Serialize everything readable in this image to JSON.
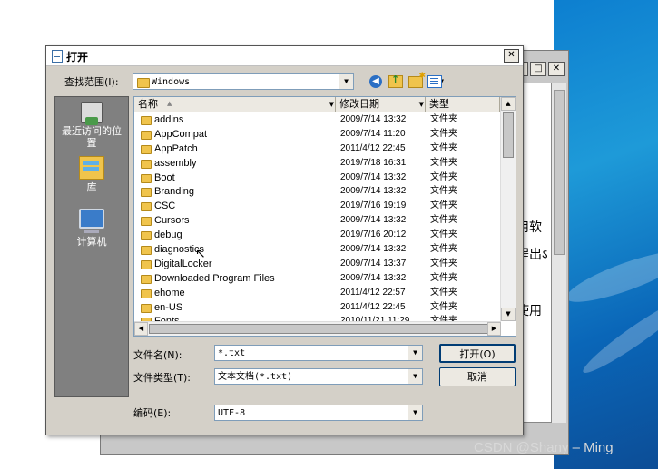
{
  "dialog": {
    "title": "打开",
    "close": "✕"
  },
  "lookin": {
    "label": "查找范围(I):",
    "value": "Windows"
  },
  "places": {
    "recent": "最近访问的位置",
    "library": "库",
    "computer": "计算机"
  },
  "columns": {
    "name": "名称",
    "date": "修改日期",
    "type": "类型"
  },
  "files": [
    {
      "name": "addins",
      "date": "2009/7/14 13:32",
      "type": "文件夹"
    },
    {
      "name": "AppCompat",
      "date": "2009/7/14 11:20",
      "type": "文件夹"
    },
    {
      "name": "AppPatch",
      "date": "2011/4/12 22:45",
      "type": "文件夹"
    },
    {
      "name": "assembly",
      "date": "2019/7/18 16:31",
      "type": "文件夹"
    },
    {
      "name": "Boot",
      "date": "2009/7/14 13:32",
      "type": "文件夹"
    },
    {
      "name": "Branding",
      "date": "2009/7/14 13:32",
      "type": "文件夹"
    },
    {
      "name": "CSC",
      "date": "2019/7/16 19:19",
      "type": "文件夹"
    },
    {
      "name": "Cursors",
      "date": "2009/7/14 13:32",
      "type": "文件夹"
    },
    {
      "name": "debug",
      "date": "2019/7/16 20:12",
      "type": "文件夹"
    },
    {
      "name": "diagnostics",
      "date": "2009/7/14 13:32",
      "type": "文件夹"
    },
    {
      "name": "DigitalLocker",
      "date": "2009/7/14 13:37",
      "type": "文件夹"
    },
    {
      "name": "Downloaded Program Files",
      "date": "2009/7/14 13:32",
      "type": "文件夹"
    },
    {
      "name": "ehome",
      "date": "2011/4/12 22:57",
      "type": "文件夹"
    },
    {
      "name": "en-US",
      "date": "2011/4/12 22:45",
      "type": "文件夹"
    },
    {
      "name": "Fonts",
      "date": "2010/11/21 11:29",
      "type": "文件夹"
    }
  ],
  "filename": {
    "label": "文件名(N):",
    "value": "*.txt"
  },
  "filetype": {
    "label": "文件类型(T):",
    "value": "文本文档(*.txt)"
  },
  "encoding": {
    "label": "编码(E):",
    "value": "UTF-8"
  },
  "buttons": {
    "open": "打开(O)",
    "cancel": "取消"
  },
  "background_window": {
    "min": "_",
    "max": "□",
    "close": "✕",
    "text_lines": [
      "用软",
      "程出ऽ",
      "使用"
    ]
  },
  "watermark": "CSDN @Shany – Ming"
}
